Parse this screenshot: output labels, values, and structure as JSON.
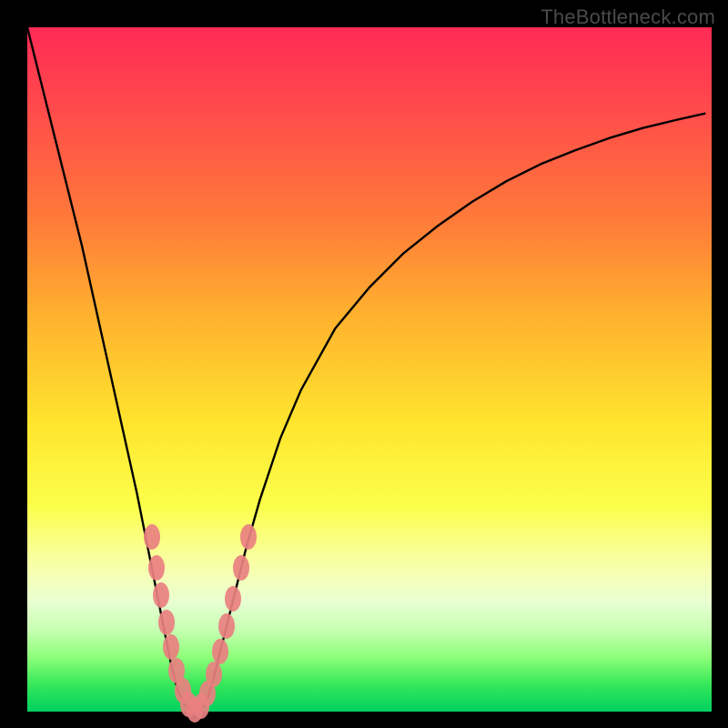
{
  "watermark": "TheBottleneck.com",
  "chart_data": {
    "type": "line",
    "title": "",
    "xlabel": "",
    "ylabel": "",
    "xlim": [
      0,
      100
    ],
    "ylim": [
      0,
      100
    ],
    "background_gradient": {
      "top_color": "#ff2a55",
      "bottom_color": "#00d060",
      "stops": [
        {
          "pos": 0,
          "color": "#ff2a55"
        },
        {
          "pos": 12,
          "color": "#ff4b4b"
        },
        {
          "pos": 28,
          "color": "#ff7a39"
        },
        {
          "pos": 42,
          "color": "#ffb12e"
        },
        {
          "pos": 58,
          "color": "#ffe52e"
        },
        {
          "pos": 70,
          "color": "#fbff4a"
        },
        {
          "pos": 76,
          "color": "#faff8f"
        },
        {
          "pos": 80,
          "color": "#f6ffb5"
        },
        {
          "pos": 84,
          "color": "#e8ffd1"
        },
        {
          "pos": 88,
          "color": "#c7ffb3"
        },
        {
          "pos": 92,
          "color": "#8eff7a"
        },
        {
          "pos": 96,
          "color": "#36e85a"
        },
        {
          "pos": 100,
          "color": "#00d060"
        }
      ]
    },
    "curve": {
      "x": [
        0,
        2,
        4,
        6,
        8,
        10,
        12,
        14,
        16,
        18,
        20,
        21,
        22,
        23,
        24,
        25,
        26,
        27,
        28,
        30,
        32,
        34,
        37,
        40,
        45,
        50,
        55,
        60,
        65,
        70,
        75,
        80,
        85,
        90,
        95,
        99
      ],
      "y": [
        100,
        92,
        84,
        76,
        68,
        59,
        50,
        41,
        32,
        22,
        12,
        7,
        3,
        1,
        0,
        0,
        1,
        4,
        8,
        16,
        24,
        31,
        40,
        47,
        56,
        62,
        67,
        71,
        74.5,
        77.5,
        80,
        82,
        83.8,
        85.3,
        86.5,
        87.4
      ]
    },
    "markers": {
      "color": "#e98080",
      "points": [
        {
          "x": 18.2,
          "y": 25.5
        },
        {
          "x": 18.9,
          "y": 21.0
        },
        {
          "x": 19.6,
          "y": 17.0
        },
        {
          "x": 20.3,
          "y": 13.0
        },
        {
          "x": 21.0,
          "y": 9.5
        },
        {
          "x": 21.8,
          "y": 6.0
        },
        {
          "x": 22.7,
          "y": 3.0
        },
        {
          "x": 23.6,
          "y": 1.0
        },
        {
          "x": 24.5,
          "y": 0.2
        },
        {
          "x": 25.4,
          "y": 0.8
        },
        {
          "x": 26.3,
          "y": 2.7
        },
        {
          "x": 27.3,
          "y": 5.5
        },
        {
          "x": 28.2,
          "y": 8.8
        },
        {
          "x": 29.1,
          "y": 12.5
        },
        {
          "x": 30.1,
          "y": 16.5
        },
        {
          "x": 31.2,
          "y": 21.0
        },
        {
          "x": 32.3,
          "y": 25.5
        }
      ]
    }
  }
}
